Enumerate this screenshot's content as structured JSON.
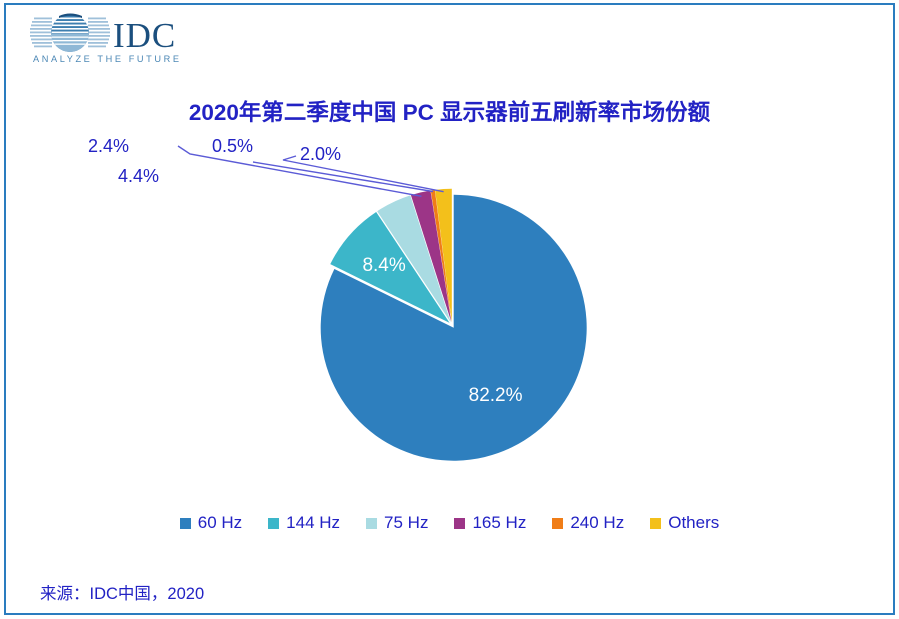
{
  "brand": {
    "name": "IDC",
    "tagline": "ANALYZE THE FUTURE",
    "logo_icon": "idc-globe-logo",
    "logo_color_dark": "#1b4f7e",
    "logo_color_light": "#7ba7cc"
  },
  "header": {
    "title": "2020年第二季度中国 PC 显示器前五刷新率市场份额",
    "title_color": "#2222c4"
  },
  "footer": {
    "source": "来源：IDC中国，2020"
  },
  "frame": {
    "border_color": "#2a7cbf"
  },
  "chart_data": {
    "type": "pie",
    "title": "2020年第二季度中国 PC 显示器前五刷新率市场份额",
    "xlabel": "",
    "ylabel": "",
    "legend_position": "bottom",
    "grid": false,
    "categories": [
      "60 Hz",
      "144 Hz",
      "75 Hz",
      "165 Hz",
      "240 Hz",
      "Others"
    ],
    "values": [
      82.2,
      8.4,
      4.4,
      2.4,
      0.5,
      2.0
    ],
    "value_labels": [
      "82.2%",
      "8.4%",
      "4.4%",
      "2.4%",
      "0.5%",
      "2.0%"
    ],
    "colors": [
      "#2e7fbe",
      "#3cb6c9",
      "#a9dbe2",
      "#9c3587",
      "#f07d17",
      "#f3c01b"
    ],
    "label_placement": [
      "inside",
      "inside",
      "outside",
      "outside",
      "outside",
      "outside"
    ],
    "units": "percent",
    "slices": [
      {
        "name": "60 Hz",
        "value": 82.2,
        "label": "82.2%",
        "color": "#2e7fbe"
      },
      {
        "name": "144 Hz",
        "value": 8.4,
        "label": "8.4%",
        "color": "#3cb6c9"
      },
      {
        "name": "75 Hz",
        "value": 4.4,
        "label": "4.4%",
        "color": "#a9dbe2"
      },
      {
        "name": "165 Hz",
        "value": 2.4,
        "label": "2.4%",
        "color": "#9c3587"
      },
      {
        "name": "240 Hz",
        "value": 0.5,
        "label": "0.5%",
        "color": "#f07d17"
      },
      {
        "name": "Others",
        "value": 2.0,
        "label": "2.0%",
        "color": "#f3c01b"
      }
    ]
  },
  "legend": {
    "items": [
      {
        "label": "60 Hz",
        "color": "#2e7fbe"
      },
      {
        "label": "144 Hz",
        "color": "#3cb6c9"
      },
      {
        "label": "75 Hz",
        "color": "#a9dbe2"
      },
      {
        "label": "165 Hz",
        "color": "#9c3587"
      },
      {
        "label": "240 Hz",
        "color": "#f07d17"
      },
      {
        "label": "Others",
        "color": "#f3c01b"
      }
    ]
  }
}
